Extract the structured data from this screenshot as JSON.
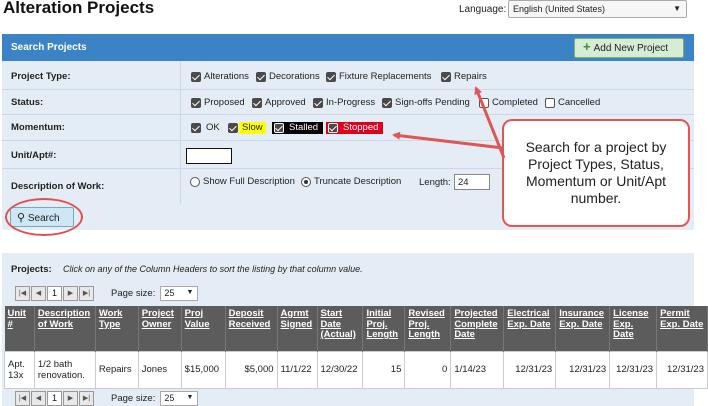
{
  "page": {
    "title": "Alteration Projects"
  },
  "language": {
    "label": "Language:",
    "selected": "English (United States)"
  },
  "search": {
    "title": "Search Projects",
    "add_button": "Add New Project",
    "labels": {
      "project_type": "Project Type:",
      "status": "Status:",
      "momentum": "Momentum:",
      "unit": "Unit/Apt#:",
      "description": "Description of Work:"
    },
    "project_types": [
      {
        "label": "Alterations",
        "checked": true
      },
      {
        "label": "Decorations",
        "checked": true
      },
      {
        "label": "Fixture Replacements",
        "checked": true
      },
      {
        "label": "Repairs",
        "checked": true
      }
    ],
    "statuses": [
      {
        "label": "Proposed",
        "checked": true
      },
      {
        "label": "Approved",
        "checked": true
      },
      {
        "label": "In-Progress",
        "checked": true
      },
      {
        "label": "Sign-offs Pending",
        "checked": true
      },
      {
        "label": "Completed",
        "checked": false
      },
      {
        "label": "Cancelled",
        "checked": false
      }
    ],
    "momentum": [
      {
        "label": "OK",
        "checked": true,
        "bg": "#e4ecf5",
        "fg": "#222222"
      },
      {
        "label": "Slow",
        "checked": true,
        "bg": "#ffff00",
        "fg": "#222222"
      },
      {
        "label": "Stalled",
        "checked": true,
        "bg": "#000000",
        "fg": "#ffffff"
      },
      {
        "label": "Stopped",
        "checked": true,
        "bg": "#e0001b",
        "fg": "#ffffff"
      }
    ],
    "unit_value": "",
    "description_options": [
      {
        "label": "Show Full Description",
        "selected": false
      },
      {
        "label": "Truncate Description",
        "selected": true
      }
    ],
    "length_label": "Length:",
    "length_value": "24",
    "search_button": "Search"
  },
  "callout": {
    "text": "Search for a project by Project Types, Status, Momentum or Unit/Apt number."
  },
  "projects": {
    "label": "Projects:",
    "hint": "Click on any of the Column Headers to sort the listing by that column value.",
    "pager": {
      "current_page": "1",
      "page_size_label": "Page size:",
      "page_size": "25"
    },
    "columns": [
      "Unit #",
      "Description of Work",
      "Work Type",
      "Project Owner",
      "Proj Value",
      "Deposit Received",
      "Agrmt Signed",
      "Start Date (Actual)",
      "Initial Proj. Length",
      "Revised Proj. Length",
      "Projected Complete Date",
      "Electrical Exp. Date",
      "Insurance Exp. Date",
      "License Exp. Date",
      "Permit Exp. Date"
    ],
    "rows": [
      [
        "Apt. 13x",
        "1/2 bath renovation.",
        "Repairs",
        "Jones",
        "$15,000",
        "$5,000",
        "11/1/22",
        "12/30/22",
        "15",
        "0",
        "1/14/23",
        "12/31/23",
        "12/31/23",
        "12/31/23",
        "12/31/23"
      ]
    ]
  },
  "colors": {
    "header_blue": "#3b83c4",
    "panel_bg": "#e4ecf5",
    "table_header": "#5c5c5c",
    "callout_border": "#e15555",
    "add_green": "#d7ecd4"
  }
}
